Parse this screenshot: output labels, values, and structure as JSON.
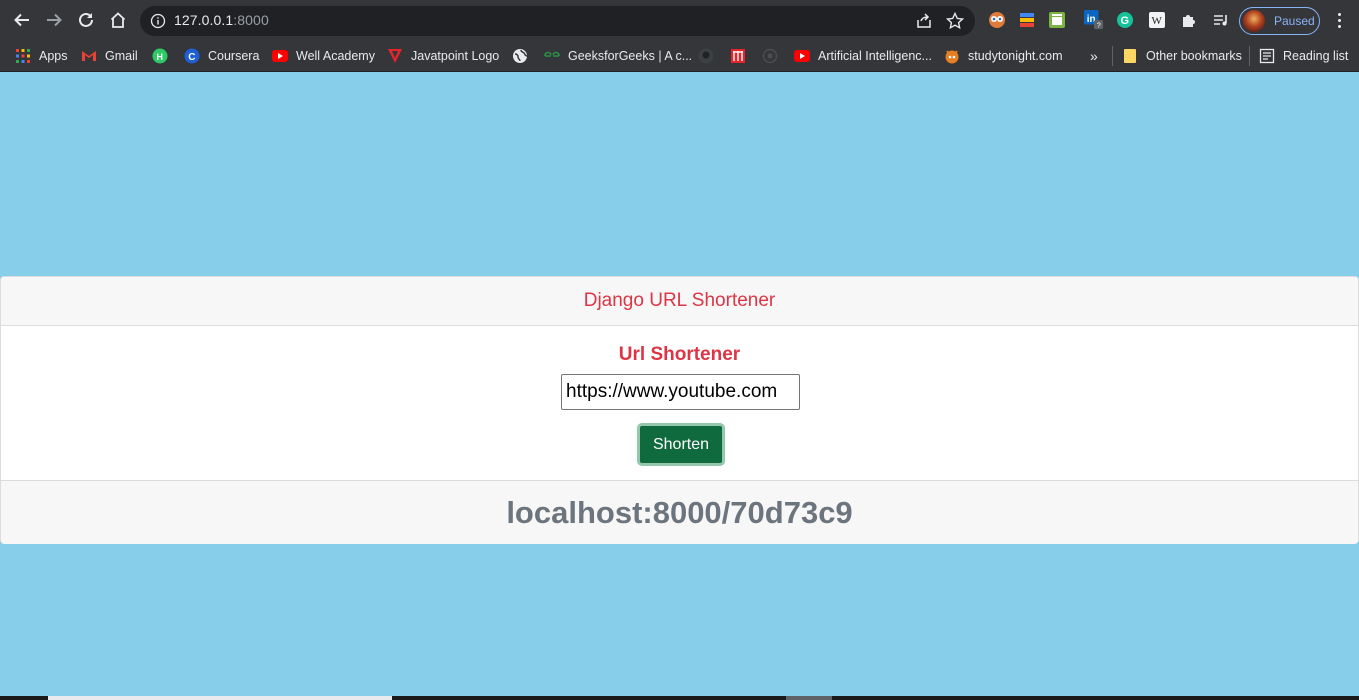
{
  "browser": {
    "url_host": "127.0.0.1",
    "url_port": ":8000",
    "profile_status": "Paused",
    "accent_color": "#8ab4f8"
  },
  "bookmarks": {
    "items": [
      {
        "label": "Apps",
        "icon": "apps-grid-icon"
      },
      {
        "label": "Gmail",
        "icon": "gmail-icon"
      },
      {
        "label": "",
        "icon": "hackerrank-icon"
      },
      {
        "label": "Coursera",
        "icon": "coursera-icon"
      },
      {
        "label": "Well Academy",
        "icon": "youtube-icon"
      },
      {
        "label": "Javatpoint Logo",
        "icon": "javatpoint-icon"
      },
      {
        "label": "",
        "icon": "globe-icon"
      },
      {
        "label": "GeeksforGeeks | A c...",
        "icon": "gfg-icon"
      },
      {
        "label": "",
        "icon": "github-icon"
      },
      {
        "label": "",
        "icon": "bookmark-app-icon"
      },
      {
        "label": "",
        "icon": "circle-icon"
      },
      {
        "label": "Artificial Intelligenc...",
        "icon": "youtube-icon"
      },
      {
        "label": "studytonight.com",
        "icon": "studytonight-icon"
      }
    ],
    "overflow": "»",
    "other_bookmarks": "Other bookmarks",
    "reading_list": "Reading list"
  },
  "page": {
    "background_color": "#87ceeb",
    "header_title": "Django URL Shortener",
    "form_title": "Url Shortener",
    "url_input_value": "https://www.youtube.com",
    "shorten_button_label": "Shorten",
    "short_url_result": "localhost:8000/70d73c9",
    "accent_red": "#dc3545",
    "button_green": "#0f6b3e"
  }
}
